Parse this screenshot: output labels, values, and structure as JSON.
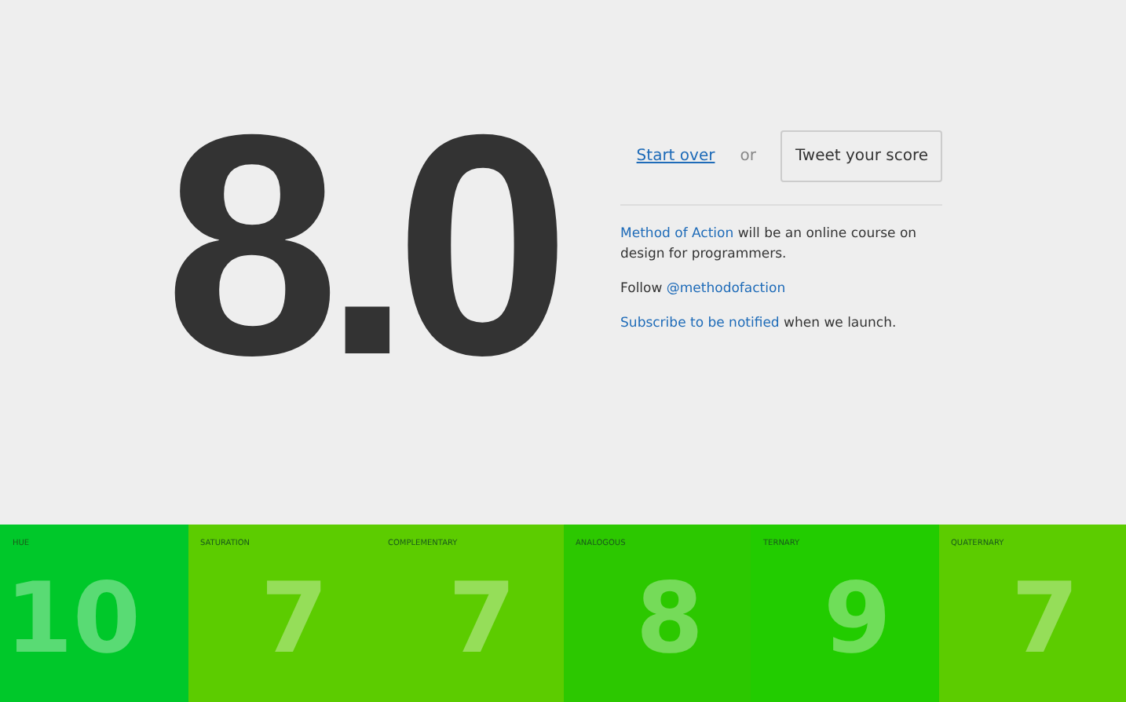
{
  "score": "8.0",
  "actions": {
    "start_over": "Start over",
    "or": "or",
    "tweet": "Tweet your score"
  },
  "info": [
    {
      "link": "Method of Action",
      "text": " will be an online course on design for programmers."
    },
    {
      "text": "Follow ",
      "link": "@methodofaction"
    },
    {
      "link": "Subscribe to be notified",
      "text": " when we launch."
    }
  ],
  "tiles": [
    {
      "label": "HUE",
      "value": "10",
      "color": "#00c82a"
    },
    {
      "label": "SATURATION",
      "value": "7",
      "color": "#5ccc00"
    },
    {
      "label": "COMPLEMENTARY",
      "value": "7",
      "color": "#5ccc00"
    },
    {
      "label": "ANALOGOUS",
      "value": "8",
      "color": "#2cc800"
    },
    {
      "label": "TERNARY",
      "value": "9",
      "color": "#22cc00"
    },
    {
      "label": "QUATERNARY",
      "value": "7",
      "color": "#5ccc00"
    }
  ]
}
